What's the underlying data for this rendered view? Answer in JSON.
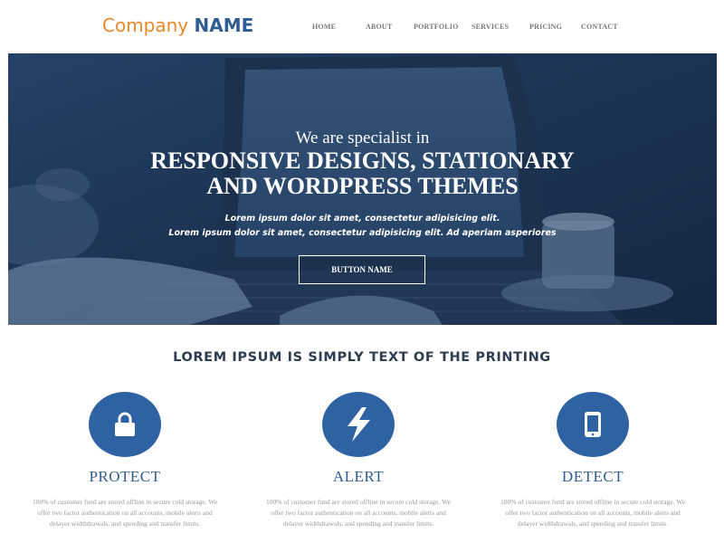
{
  "brand": {
    "word1": "Company",
    "word2": "NAME"
  },
  "nav": [
    "HOME",
    "ABOUT",
    "PORTFOLIO",
    "SERVICES",
    "PRICING",
    "CONTACT"
  ],
  "hero": {
    "intro": "We are specialist in",
    "headline_line1": "RESPONSIVE DESIGNS, STATIONARY",
    "headline_line2": "AND WORDPRESS THEMES",
    "sub_line1": "Lorem ipsum dolor sit amet, consectetur adipisicing elit.",
    "sub_line2": "Lorem ipsum dolor sit amet, consectetur adipisicing elit. Ad aperiam asperiores",
    "button_label": "BUTTON NAME"
  },
  "section": {
    "title": "LOREM IPSUM IS SIMPLY TEXT OF THE PRINTING"
  },
  "features": [
    {
      "icon": "lock-icon",
      "title": "PROTECT",
      "desc": "100% of customer fund are stored offline in secure cold storage. We offer two factor authentication on all accounts, mobile alerts and delayer widthdrawals, and spending and transfer limits."
    },
    {
      "icon": "lightning-bolt-icon",
      "title": "ALERT",
      "desc": "100% of customer fund are stored offline in secure cold storage. We offer two factor authentication on all accounts, mobile alerts and delayer widthdrawals, and spending and transfer limits."
    },
    {
      "icon": "mobile-phone-icon",
      "title": "DETECT",
      "desc": "100% of customer fund are stored offline in secure cold storage. We offer two factor authentication on all accounts, mobile alerts and delayer widthdrawals, and spending and transfer limits."
    }
  ],
  "colors": {
    "brand_orange": "#e8882c",
    "brand_blue": "#2f5d91",
    "icon_circle": "#2f62a3",
    "heading_dark": "#2e3d52"
  }
}
